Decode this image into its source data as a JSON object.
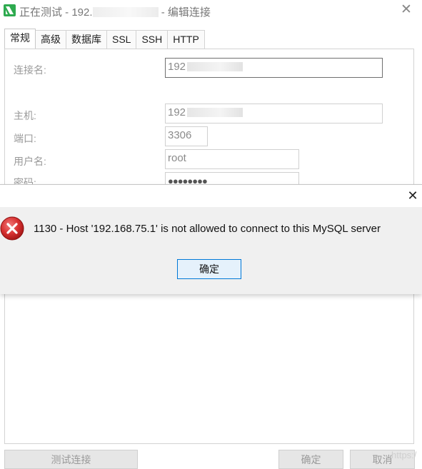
{
  "window": {
    "title_prefix": "正在测试 - 192.",
    "title_suffix": "- 编辑连接",
    "close_glyph": "✕"
  },
  "tabs": [
    {
      "label": "常规",
      "active": true
    },
    {
      "label": "高级",
      "active": false
    },
    {
      "label": "数据库",
      "active": false
    },
    {
      "label": "SSL",
      "active": false
    },
    {
      "label": "SSH",
      "active": false
    },
    {
      "label": "HTTP",
      "active": false
    }
  ],
  "form": {
    "connection_name_label": "连接名:",
    "connection_name_value": "192",
    "host_label": "主机:",
    "host_value": "192",
    "port_label": "端口:",
    "port_value": "3306",
    "user_label": "用户名:",
    "user_value": "root",
    "password_label": "密码:",
    "password_value": "●●●●●●●●"
  },
  "bottom_buttons": {
    "test": "测试连接",
    "ok": "确定",
    "cancel": "取消"
  },
  "watermark": "https:/",
  "dialog": {
    "close_glyph": "✕",
    "message": "1130 - Host '192.168.75.1' is not allowed to connect to this MySQL server",
    "ok": "确定",
    "icon": "error-icon"
  },
  "colors": {
    "accent_border": "#0078d7",
    "ok_button_bg": "#e5f1fb",
    "error_red": "#c62828",
    "app_icon_green": "#2eaa4f"
  }
}
